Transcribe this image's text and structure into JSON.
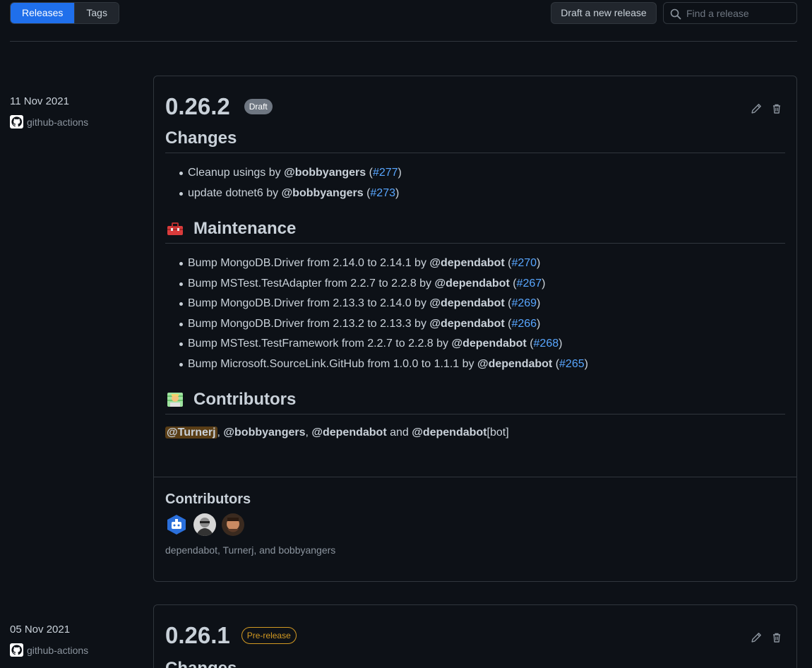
{
  "tabs": {
    "releases": "Releases",
    "tags": "Tags"
  },
  "toolbar": {
    "draft_label": "Draft a new release",
    "search_placeholder": "Find a release"
  },
  "releases": [
    {
      "date": "11 Nov 2021",
      "author": "github-actions",
      "version": "0.26.2",
      "badge": "Draft",
      "sections": {
        "changes": {
          "heading": "Changes",
          "items": [
            {
              "text": "Cleanup usings by ",
              "user": "@bobbyangers",
              "pr": "#277"
            },
            {
              "text": "update dotnet6 by ",
              "user": "@bobbyangers",
              "pr": "#273"
            }
          ]
        },
        "maintenance": {
          "heading": "Maintenance",
          "items": [
            {
              "text": "Bump MongoDB.Driver from 2.14.0 to 2.14.1 by ",
              "user": "@dependabot",
              "pr": "#270"
            },
            {
              "text": "Bump MSTest.TestAdapter from 2.2.7 to 2.2.8 by ",
              "user": "@dependabot",
              "pr": "#267"
            },
            {
              "text": "Bump MongoDB.Driver from 2.13.3 to 2.14.0 by ",
              "user": "@dependabot",
              "pr": "#269"
            },
            {
              "text": "Bump MongoDB.Driver from 2.13.2 to 2.13.3 by ",
              "user": "@dependabot",
              "pr": "#266"
            },
            {
              "text": "Bump MSTest.TestFramework from 2.2.7 to 2.2.8 by ",
              "user": "@dependabot",
              "pr": "#268"
            },
            {
              "text": "Bump Microsoft.SourceLink.GitHub from 1.0.0 to 1.1.1 by ",
              "user": "@dependabot",
              "pr": "#265"
            }
          ]
        },
        "contributors": {
          "heading": "Contributors",
          "users": [
            "@Turnerj",
            "@bobbyangers",
            "@dependabot",
            "@dependabot"
          ],
          "sep": ", ",
          "and": " and ",
          "bot_suffix": "[bot]"
        }
      },
      "footer": {
        "heading": "Contributors",
        "names": "dependabot, Turnerj, and bobbyangers"
      }
    },
    {
      "date": "05 Nov 2021",
      "author": "github-actions",
      "version": "0.26.1",
      "badge": "Pre-release",
      "next_heading": "Changes"
    }
  ],
  "paren_open": "(",
  "paren_close": ")",
  "colors": {
    "accent": "#1f6feb",
    "link": "#58a6ff",
    "prerelease": "#d29922",
    "draft": "#6e7681"
  }
}
